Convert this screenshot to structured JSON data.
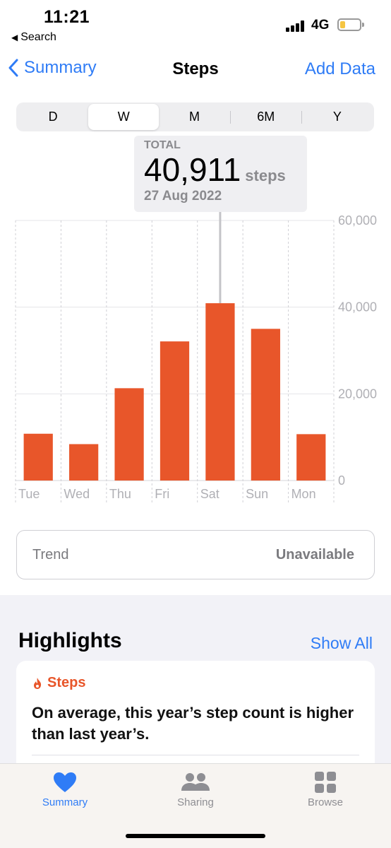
{
  "status": {
    "time": "11:21",
    "back_label": "Search",
    "network": "4G"
  },
  "nav": {
    "back_label": "Summary",
    "title": "Steps",
    "action_label": "Add Data"
  },
  "segments": {
    "items": [
      "D",
      "W",
      "M",
      "6M",
      "Y"
    ],
    "selected": "W"
  },
  "callout": {
    "label": "TOTAL",
    "value": "40,911",
    "unit": "steps",
    "date": "27 Aug 2022"
  },
  "chart_data": {
    "type": "bar",
    "categories": [
      "Tue",
      "Wed",
      "Thu",
      "Fri",
      "Sat",
      "Sun",
      "Mon"
    ],
    "values": [
      10800,
      8400,
      21300,
      32100,
      40911,
      35000,
      10700
    ],
    "ylim": [
      0,
      60000
    ],
    "yticks": [
      "60,000",
      "40,000",
      "20,000",
      "0"
    ],
    "ytick_values": [
      60000,
      40000,
      20000,
      0
    ],
    "selected_index": 4,
    "bar_color": "#e8562a",
    "grid": true
  },
  "trend": {
    "label": "Trend",
    "value": "Unavailable"
  },
  "highlights": {
    "title": "Highlights",
    "show_all": "Show All",
    "card": {
      "category": "Steps",
      "text": "On average, this year’s step count is higher than last year’s."
    }
  },
  "tabbar": {
    "items": [
      {
        "label": "Summary",
        "icon": "heart-icon",
        "active": true
      },
      {
        "label": "Sharing",
        "icon": "people-icon",
        "active": false
      },
      {
        "label": "Browse",
        "icon": "grid-icon",
        "active": false
      }
    ]
  },
  "colors": {
    "accent": "#2f7cf6",
    "steps": "#e8562a"
  }
}
